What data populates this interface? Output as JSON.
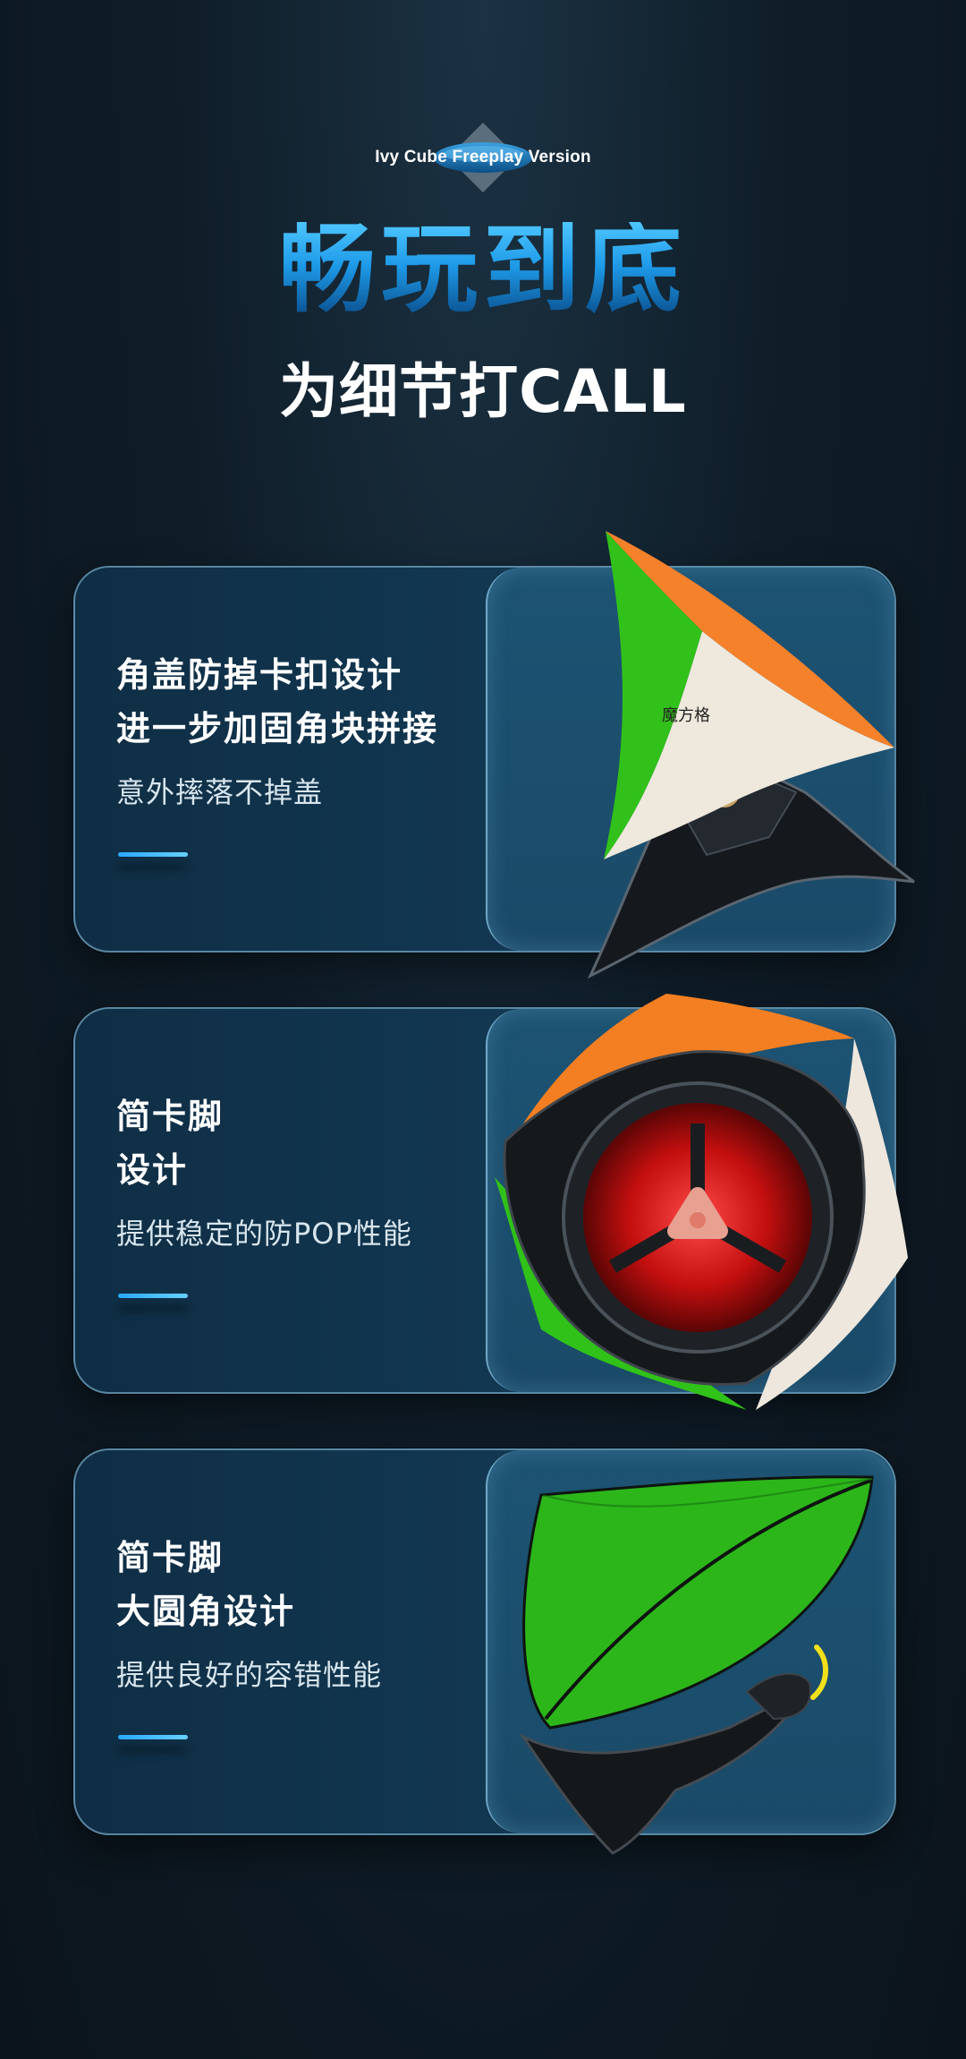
{
  "header": {
    "badge_text": "Ivy Cube Freeplay Version",
    "title": "畅玩到底",
    "subtitle": "为细节打CALL"
  },
  "colors": {
    "accent_blue": "#2aa8ff",
    "title_gradient_top": "#4ec6ff",
    "title_gradient_bottom": "#0a4e8c",
    "cube_green": "#35c21a",
    "cube_orange": "#f6822a",
    "cube_white": "#efe9e0",
    "core_red": "#d21414"
  },
  "features": [
    {
      "heading_line1": "角盖防掉卡扣设计",
      "heading_line2": "进一步加固角块拼接",
      "description": "意外摔落不掉盖",
      "image": "ivy-cube-corner-clip-image"
    },
    {
      "heading_line1": "简卡脚",
      "heading_line2": "设计",
      "description": "提供稳定的防POP性能",
      "image": "ivy-cube-core-image"
    },
    {
      "heading_line1": "简卡脚",
      "heading_line2": "大圆角设计",
      "description": "提供良好的容错性能",
      "image": "ivy-cube-round-corner-image"
    }
  ]
}
